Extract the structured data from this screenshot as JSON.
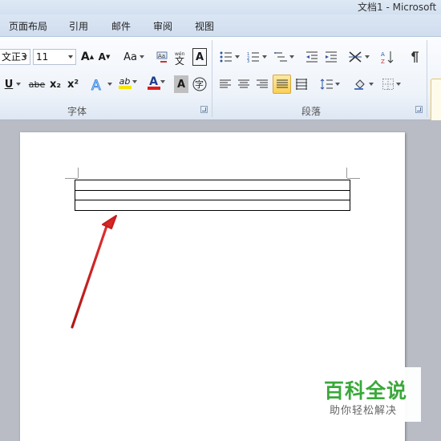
{
  "window": {
    "title": "文档1  -  Microsoft"
  },
  "tabs": [
    "页面布局",
    "引用",
    "邮件",
    "审阅",
    "视图"
  ],
  "font_group": {
    "label": "字体",
    "font_name": "文正3",
    "font_size": "11",
    "change_case": "Aa",
    "underline": "U",
    "strikethrough": "abe",
    "subscript": "x₂",
    "superscript": "x²",
    "phonetic_guide": "wén",
    "char_border": "A",
    "char_shading": "A",
    "enclose_char": "字",
    "highlight": "ab",
    "font_color": "A",
    "grow_font": "A",
    "shrink_font": "A"
  },
  "paragraph_group": {
    "label": "段落"
  },
  "accent_colors": {
    "highlight": "#f5e500",
    "font_color": "#e01c1c",
    "arrow": "#cc1f1f",
    "watermark_green": "#3aa83a"
  },
  "watermark": {
    "brand": "百科全说",
    "slogan": "助你轻松解决"
  }
}
